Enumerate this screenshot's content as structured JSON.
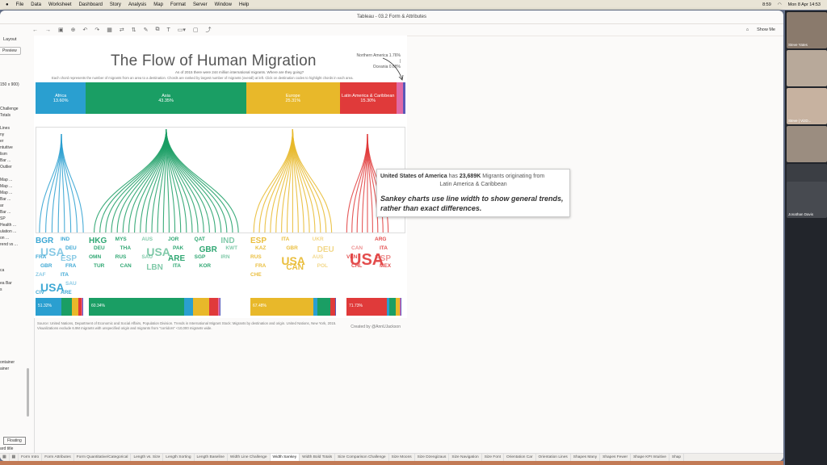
{
  "menubar": {
    "apple": "",
    "items": [
      "File",
      "Data",
      "Worksheet",
      "Dashboard",
      "Story",
      "Analysis",
      "Map",
      "Format",
      "Server",
      "Window",
      "Help"
    ],
    "right": [
      "8:59",
      "Mon 8 Apr  14:53"
    ]
  },
  "window": {
    "title": "Tableau - 03.2 Form & Attributes",
    "show_me": "Show Me"
  },
  "sidebar": {
    "tabs": [
      "Layout"
    ],
    "preview_label": "Preview",
    "size_label": "150 x 900)",
    "items": [
      "Challenge",
      "Totals",
      "Lines",
      "ny",
      "er",
      "ntuitive",
      "lism",
      "Bar ...",
      "Outlier",
      "Map ...",
      "Map ...",
      "Map ...",
      "Bar ...",
      "ar",
      "Bar ...",
      "SP",
      "Health ...",
      "ulation ...",
      "on ...",
      "rend vs ...",
      "ca",
      "ea Bar",
      "s",
      "ontainer",
      "ainer"
    ],
    "floating": "Floating",
    "dashboard_title": "ard title"
  },
  "dashboard": {
    "title": "The Flow of Human Migration",
    "subnote": "As of 2015 there were 244 million international migrants.  Where are they going?",
    "subnote2": "Each chord represents the number of migrants from an area to a destination.  Chords are ranked by largest number of migrants (overall) at left.  Click on destination codes to highlight chords in each area.",
    "annotation": [
      "Northern America 1.76%",
      "|",
      "Oceania 0.68%"
    ],
    "categories": [
      {
        "name": "Africa",
        "pct": "13.60%",
        "color": "#2a9fd0",
        "share": 0.136
      },
      {
        "name": "Asia",
        "pct": "43.35%",
        "color": "#1a9e64",
        "share": 0.4335
      },
      {
        "name": "Europe",
        "pct": "25.31%",
        "color": "#e8b82a",
        "share": 0.2531
      },
      {
        "name": "Latin America & Caribbean",
        "pct": "15.30%",
        "color": "#e03a3a",
        "share": 0.153
      },
      {
        "name": "",
        "pct": "",
        "color": "#e06aa6",
        "share": 0.0176
      },
      {
        "name": "",
        "pct": "",
        "color": "#5a58b8",
        "share": 0.0068
      }
    ],
    "word_cols": [
      {
        "color": "#2a9fd0",
        "words": [
          "BGR",
          "IND",
          "USA",
          "DEU",
          "FRA",
          "ESP",
          "GBR",
          "FRA",
          "ZAF",
          "ITA",
          "USA",
          "SAU",
          "CIV",
          "ARE",
          "USA",
          "GBR"
        ]
      },
      {
        "color": "#1a9e64",
        "words": [
          "HKG",
          "MYS",
          "AUS",
          "JOR",
          "QAT",
          "IND",
          "DEU",
          "THA",
          "USA",
          "PAK",
          "GBR",
          "KWT",
          "OMN",
          "RUS",
          "SAU",
          "ARE",
          "SGP",
          "IRN",
          "TUR",
          "CAN",
          "LBN",
          "ITA",
          "KOR"
        ]
      },
      {
        "color": "#e8b82a",
        "words": [
          "ESP",
          "ITA",
          "UKR",
          "KAZ",
          "GBR",
          "DEU",
          "RUS",
          "USA",
          "AUS",
          "FRA",
          "CAN",
          "POL",
          "CHE"
        ]
      },
      {
        "color": "#e03a3a",
        "words": [
          "USA",
          "ARG",
          "CAN",
          "ITA",
          "VEN",
          "ESP",
          "CHL",
          "MEX"
        ]
      }
    ],
    "bottom_bars": [
      {
        "label": "51.32%"
      },
      {
        "label": "60.34%"
      },
      {
        "label": "67.48%"
      },
      {
        "label": "71.73%"
      }
    ],
    "source": "Source: United Nations, Department of Economic and Social Affairs, Population Division. Trends in International Migrant Stock: Migrants by destination and origin. United Nations, New York, 2015.  Visualizations exclude 6.9M migrants with unspecified origin and migrants from \"corridors\" <10,000 migrants wide.",
    "credit": "Created by @AnnUJackson"
  },
  "tooltip": {
    "country": "United States of America",
    "has": "has",
    "value": "23,689K",
    "mid": "Migrants originating from",
    "origin": "Latin America & Caribbean",
    "note": "Sankey charts use line width to show general trends, rather than exact differences."
  },
  "tabs": [
    "Form Intro",
    "Form Attributes",
    "Form Quantitative/Categorical",
    "Length vs. Size",
    "Length Sorting",
    "Length Baseline",
    "Width Line Challenge",
    "Width Sankey",
    "Width Bold Totals",
    "Size Comparison Challenge",
    "Size Moons",
    "Size Dzengizaus",
    "Size Navigation",
    "Size Font",
    "Orientation Car",
    "Orientation Lines",
    "Shapes Many",
    "Shapes Fewer",
    "Shape KPI Intuitive",
    "Shap"
  ],
  "active_tab": "Width Sankey",
  "participants": [
    "Steve Yates",
    "Steve | VizD...",
    "Jonathan Davis"
  ]
}
